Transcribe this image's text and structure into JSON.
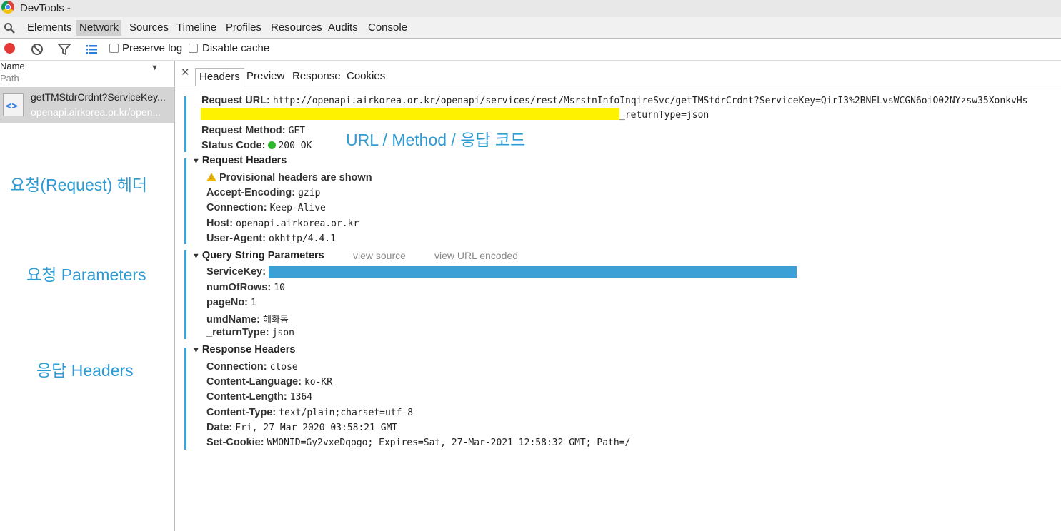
{
  "window": {
    "title": "DevTools -"
  },
  "tabs": [
    "Elements",
    "Network",
    "Sources",
    "Timeline",
    "Profiles",
    "Resources",
    "Audits",
    "Console"
  ],
  "toolbar": {
    "preserve_log": "Preserve log",
    "disable_cache": "Disable cache"
  },
  "request_list": {
    "col_name": "Name",
    "col_path": "Path",
    "item": {
      "name": "getTMStdrCrdnt?ServiceKey...",
      "domain": "openapi.airkorea.or.kr/open..."
    }
  },
  "annotations": {
    "url_method": "URL / Method / 응답 코드",
    "request_headers": "요청(Request) 헤더",
    "request_params": "요청 Parameters",
    "response_headers": "응답 Headers"
  },
  "detail_tabs": [
    "Headers",
    "Preview",
    "Response",
    "Cookies"
  ],
  "general": {
    "request_url_label": "Request URL:",
    "request_url": "http://openapi.airkorea.or.kr/openapi/services/rest/MsrstnInfoInqireSvc/getTMStdrCrdnt?ServiceKey=QirI3%2BNELvsWCGN6oiO02NYzsw35XonkvHs",
    "request_url_tail": "_returnType=json",
    "method_label": "Request Method:",
    "method": "GET",
    "status_label": "Status Code:",
    "status": "200 OK",
    "status_color": "#2eb82e"
  },
  "request_headers": {
    "title": "Request Headers",
    "warning": "Provisional headers are shown",
    "items": [
      {
        "k": "Accept-Encoding:",
        "v": "gzip"
      },
      {
        "k": "Connection:",
        "v": "Keep-Alive"
      },
      {
        "k": "Host:",
        "v": "openapi.airkorea.or.kr"
      },
      {
        "k": "User-Agent:",
        "v": "okhttp/4.4.1"
      }
    ]
  },
  "query_params": {
    "title": "Query String Parameters",
    "view_source": "view source",
    "view_url_encoded": "view URL encoded",
    "items": [
      {
        "k": "ServiceKey:",
        "v": ""
      },
      {
        "k": "numOfRows:",
        "v": "10"
      },
      {
        "k": "pageNo:",
        "v": "1"
      },
      {
        "k": "umdName:",
        "v": "혜화동"
      },
      {
        "k": "_returnType:",
        "v": "json"
      }
    ]
  },
  "response_headers": {
    "title": "Response Headers",
    "items": [
      {
        "k": "Connection:",
        "v": "close"
      },
      {
        "k": "Content-Language:",
        "v": "ko-KR"
      },
      {
        "k": "Content-Length:",
        "v": "1364"
      },
      {
        "k": "Content-Type:",
        "v": "text/plain;charset=utf-8"
      },
      {
        "k": "Date:",
        "v": "Fri, 27 Mar 2020 03:58:21 GMT"
      },
      {
        "k": "Set-Cookie:",
        "v": "WMONID=Gy2vxeDqogo; Expires=Sat, 27-Mar-2021 12:58:32 GMT; Path=/"
      }
    ]
  }
}
